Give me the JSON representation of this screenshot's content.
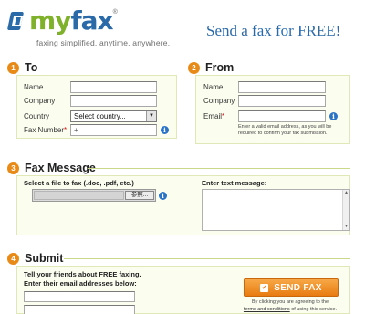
{
  "header": {
    "logo": {
      "my": "my",
      "fax": "fax",
      "reg": "®"
    },
    "tagline": "faxing simplified. anytime. anywhere.",
    "promo": "Send a fax for FREE!"
  },
  "sections": {
    "to": {
      "number": "1",
      "title": "To",
      "name_label": "Name",
      "company_label": "Company",
      "country_label": "Country",
      "country_selected": "Select country...",
      "faxnumber_label": "Fax Number",
      "required_mark": "*",
      "faxnumber_value": "+"
    },
    "from": {
      "number": "2",
      "title": "From",
      "name_label": "Name",
      "company_label": "Company",
      "email_label": "Email",
      "required_mark": "*",
      "email_note": "Enter a valid email address, as you will be required to confirm your fax submission."
    },
    "message": {
      "number": "3",
      "title": "Fax Message",
      "file_label": "Select a file to fax (.doc, .pdf, etc.)",
      "browse_label": "参照...",
      "text_label": "Enter text message:"
    },
    "submit": {
      "number": "4",
      "title": "Submit",
      "friends_label": "Tell your friends about FREE faxing.\nEnter their email addresses below:",
      "send_label": "SEND FAX",
      "agree_line1": "By clicking you are agreeing to the",
      "agree_link": "terms and conditions",
      "agree_line2": "of using this service."
    }
  },
  "icons": {
    "info": "info-icon",
    "check": "check-icon",
    "dropdown": "chevron-down-icon"
  },
  "colors": {
    "accent_orange": "#e88a18",
    "brand_blue": "#2a6aa8",
    "brand_green": "#7fb22a",
    "panel_bg": "#fbfdef"
  }
}
